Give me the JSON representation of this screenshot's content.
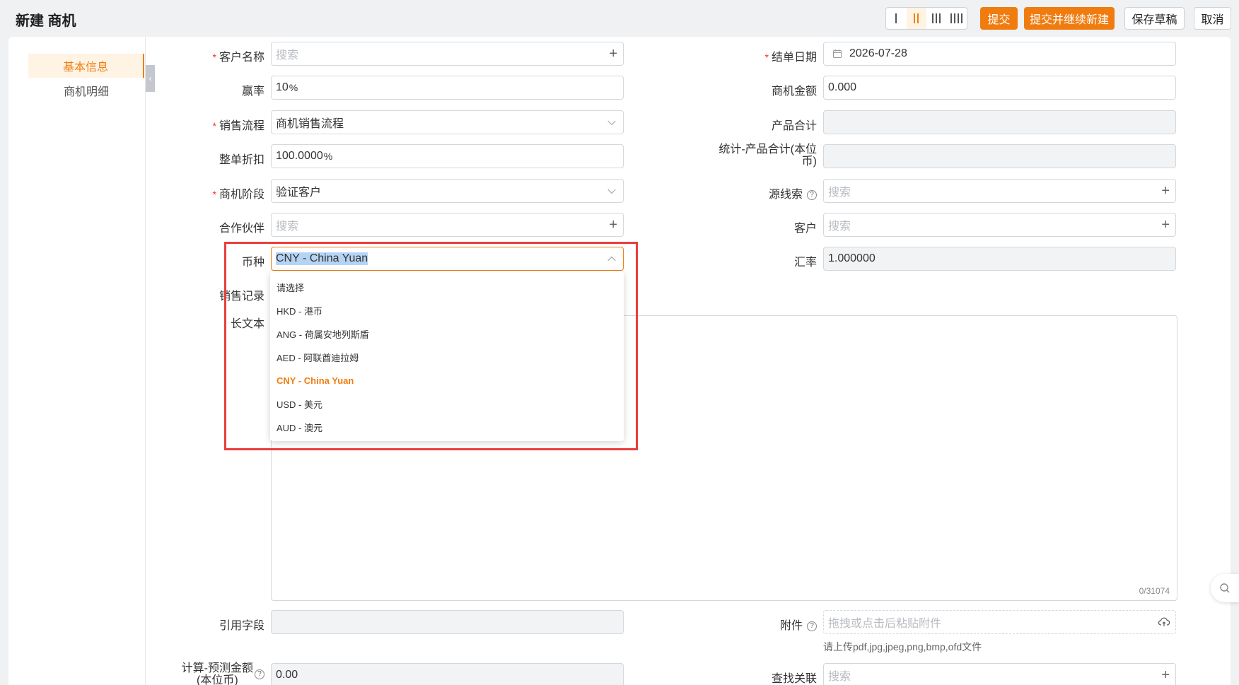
{
  "header": {
    "title": "新建 商机",
    "submit": "提交",
    "submit_continue": "提交并继续新建",
    "save_draft": "保存草稿",
    "cancel": "取消"
  },
  "nav": {
    "basic_info": "基本信息",
    "detail": "商机明细"
  },
  "form": {
    "customer_name": {
      "label": "客户名称",
      "placeholder": "搜索"
    },
    "close_date": {
      "label": "结单日期",
      "value": "2026-07-28"
    },
    "win_rate": {
      "label": "赢率",
      "value": "10",
      "unit": "%"
    },
    "amount": {
      "label": "商机金额",
      "value": "0.000"
    },
    "sales_process": {
      "label": "销售流程",
      "value": "商机销售流程"
    },
    "product_total": {
      "label": "产品合计",
      "value": ""
    },
    "discount": {
      "label": "整单折扣",
      "value": "100.0000",
      "unit": "%"
    },
    "stat_product_total": {
      "label_line1": "统计-产品合计(本位",
      "label_line2": "币)",
      "value": ""
    },
    "stage": {
      "label": "商机阶段",
      "value": "验证客户"
    },
    "source_lead": {
      "label": "源线索",
      "placeholder": "搜索"
    },
    "partner": {
      "label": "合作伙伴",
      "placeholder": "搜索"
    },
    "customer": {
      "label": "客户",
      "placeholder": "搜索"
    },
    "currency": {
      "label": "币种",
      "value": "CNY - China Yuan"
    },
    "exchange_rate": {
      "label": "汇率",
      "value": "1.000000"
    },
    "sales_record": {
      "label": "销售记录"
    },
    "long_text": {
      "label": "长文本",
      "counter": "0/31074"
    },
    "ref_field": {
      "label": "引用字段",
      "value": ""
    },
    "attachment": {
      "label": "附件",
      "placeholder": "拖拽或点击后粘贴附件",
      "hint": "请上传pdf,jpg,jpeg,png,bmp,ofd文件"
    },
    "calc_amount": {
      "label_line1": "计算-预测金额",
      "label_line2": "(本位币)",
      "value": "0.00"
    },
    "lookup": {
      "label": "查找关联",
      "placeholder": "搜索"
    }
  },
  "currency_options": [
    "请选择",
    "HKD - 港币",
    "ANG - 荷属安地列斯盾",
    "AED - 阿联酋迪拉姆",
    "CNY - China Yuan",
    "USD - 美元",
    "AUD - 澳元"
  ],
  "colors": {
    "accent": "#f07c10",
    "highlight_box": "#ea3d3d"
  }
}
